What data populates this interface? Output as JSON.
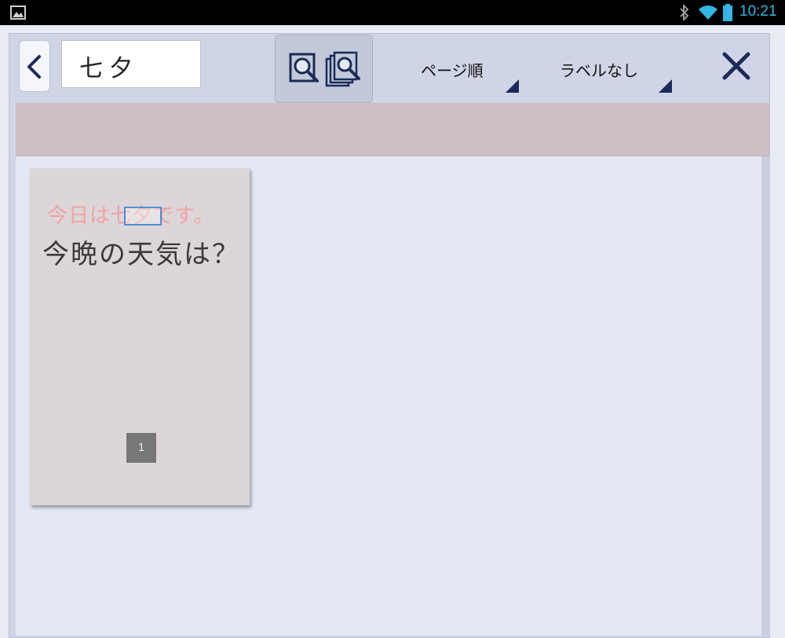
{
  "status_bar": {
    "time": "10:21",
    "icons": [
      "gallery-icon",
      "bluetooth-icon",
      "wifi-icon",
      "battery-icon"
    ],
    "accent_color": "#33b5e5"
  },
  "toolbar": {
    "back_icon": "chevron-left-icon",
    "search_query": "七夕",
    "search_mode_icon": "multi-page-search-icon",
    "sort_dropdown_label": "ページ順",
    "label_dropdown_label": "ラベルなし",
    "close_icon": "close-icon",
    "accent_color": "#1b2a59"
  },
  "results": [
    {
      "page_number": "1",
      "line1": "今日は七夕です。",
      "line1_highlight": "七夕",
      "line2": "今晩の天気は？"
    }
  ]
}
